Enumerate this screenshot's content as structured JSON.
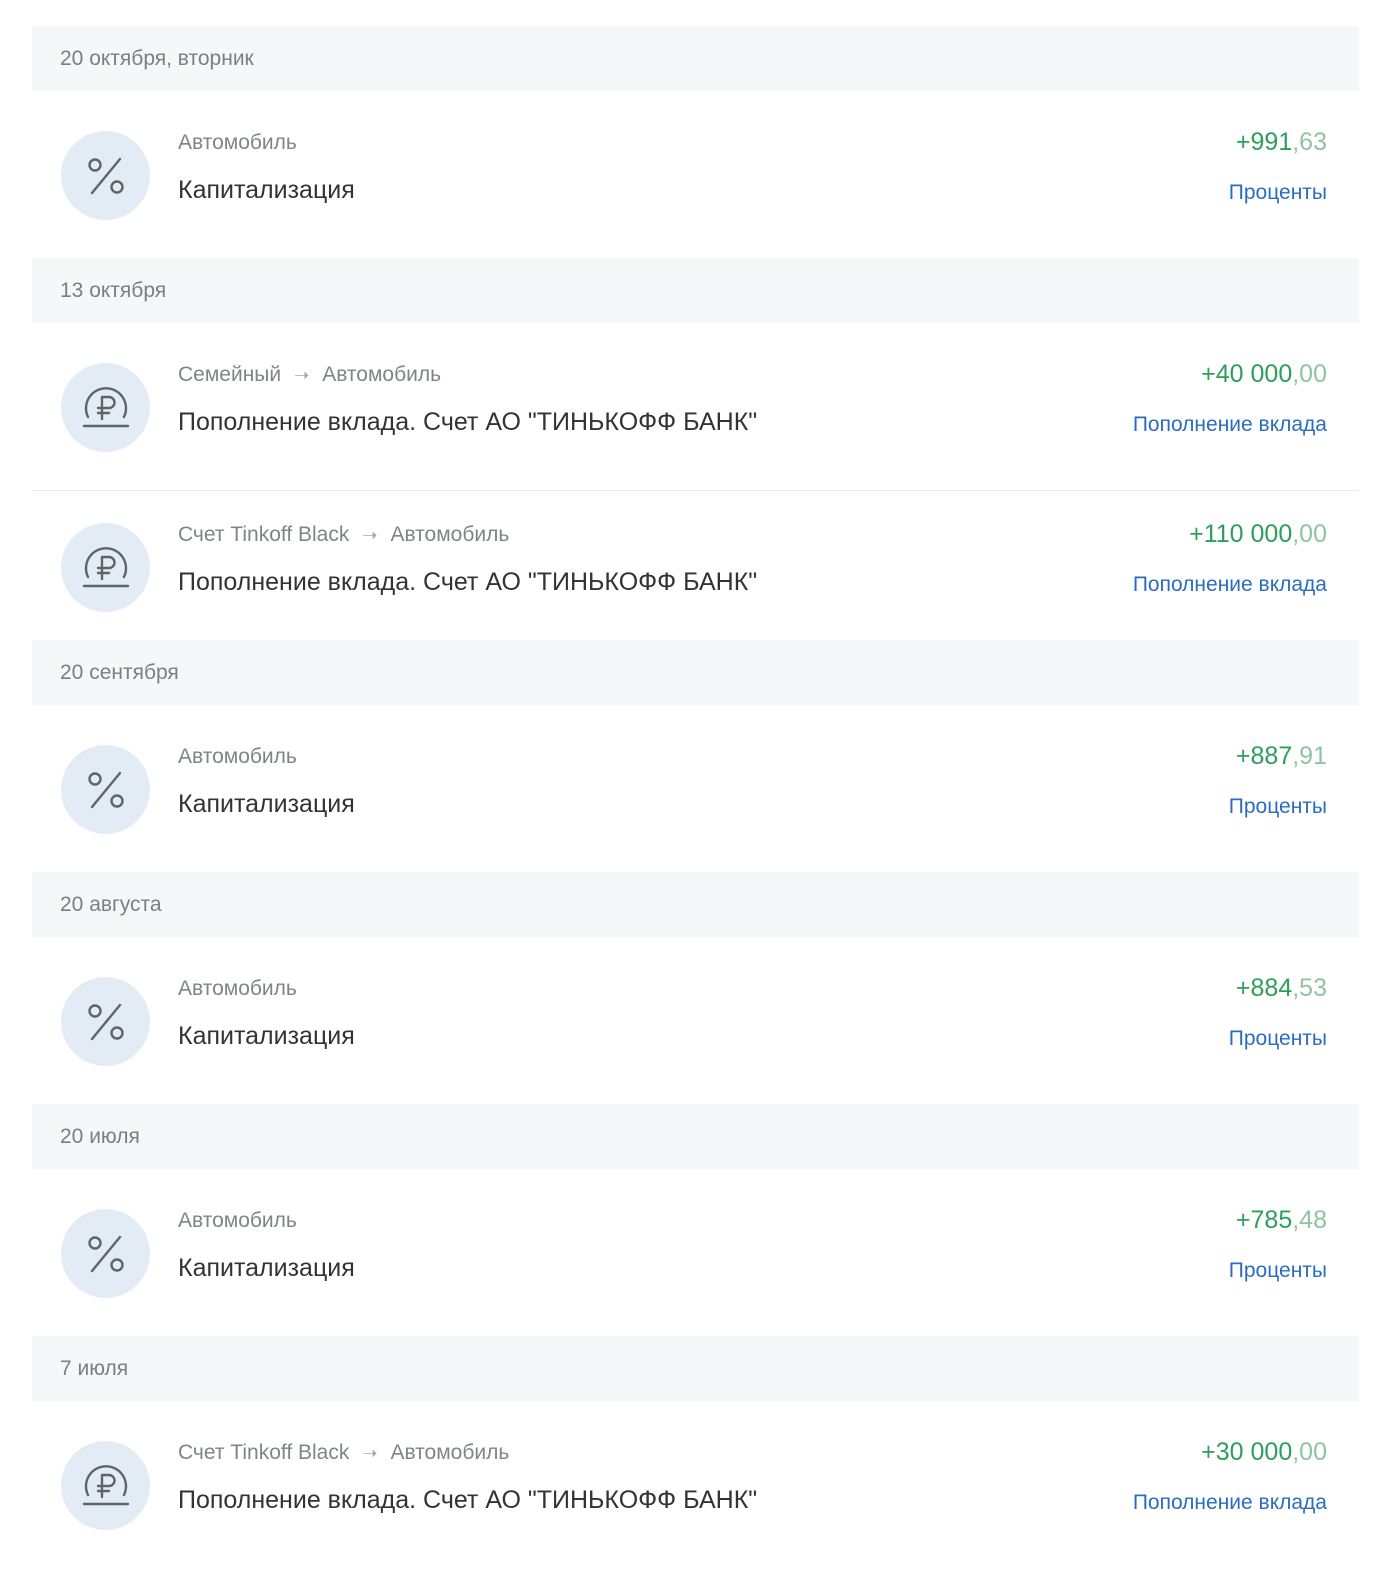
{
  "groups": [
    {
      "date": "20 октября, вторник",
      "operations": [
        {
          "icon": "percent-icon",
          "from": "Автомобиль",
          "to": "",
          "title": "Капитализация",
          "amount_int": "+991",
          "amount_frac": ",63",
          "category": "Проценты"
        }
      ]
    },
    {
      "date": "13 октября",
      "operations": [
        {
          "icon": "ruble-icon",
          "from": "Семейный",
          "to": "Автомобиль",
          "title": "Пополнение вклада. Счет АО \"ТИНЬКОФФ БАНК\"",
          "amount_int": "+40 000",
          "amount_frac": ",00",
          "category": "Пополнение вклада"
        },
        {
          "icon": "ruble-icon",
          "from": "Счет Tinkoff Black",
          "to": "Автомобиль",
          "title": "Пополнение вклада. Счет АО \"ТИНЬКОФФ БАНК\"",
          "amount_int": "+110 000",
          "amount_frac": ",00",
          "category": "Пополнение вклада"
        }
      ]
    },
    {
      "date": "20 сентября",
      "operations": [
        {
          "icon": "percent-icon",
          "from": "Автомобиль",
          "to": "",
          "title": "Капитализация",
          "amount_int": "+887",
          "amount_frac": ",91",
          "category": "Проценты"
        }
      ]
    },
    {
      "date": "20 августа",
      "operations": [
        {
          "icon": "percent-icon",
          "from": "Автомобиль",
          "to": "",
          "title": "Капитализация",
          "amount_int": "+884",
          "amount_frac": ",53",
          "category": "Проценты"
        }
      ]
    },
    {
      "date": "20 июля",
      "operations": [
        {
          "icon": "percent-icon",
          "from": "Автомобиль",
          "to": "",
          "title": "Капитализация",
          "amount_int": "+785",
          "amount_frac": ",48",
          "category": "Проценты"
        }
      ]
    },
    {
      "date": "7 июля",
      "operations": [
        {
          "icon": "ruble-icon",
          "from": "Счет Tinkoff Black",
          "to": "Автомобиль",
          "title": "Пополнение вклада. Счет АО \"ТИНЬКОФФ БАНК\"",
          "amount_int": "+30 000",
          "amount_frac": ",00",
          "category": "Пополнение вклада"
        }
      ]
    }
  ]
}
